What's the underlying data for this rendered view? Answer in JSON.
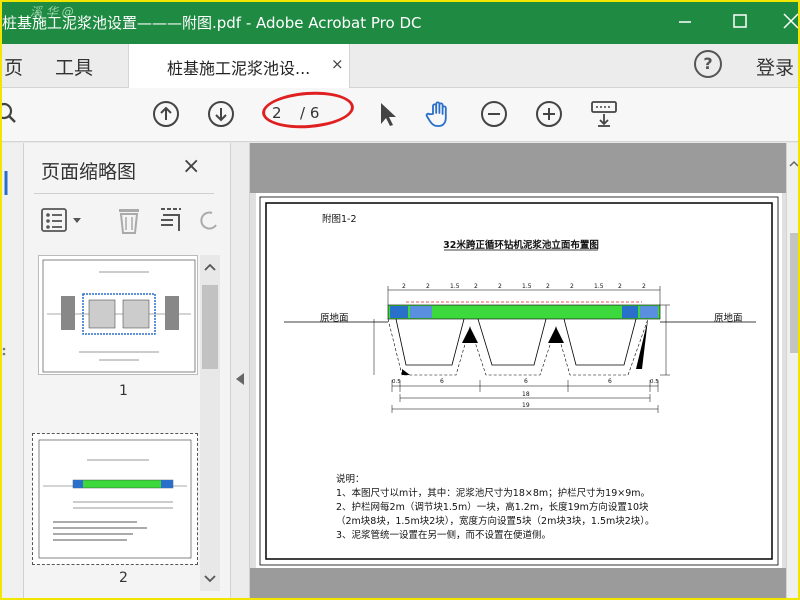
{
  "window": {
    "title": "桩基施工泥浆池设置———附图.pdf - Adobe Acrobat Pro DC",
    "watermark": "溪 华 @"
  },
  "menu": {
    "home": "页",
    "tools": "工具",
    "login": "登录"
  },
  "tab": {
    "label": "桩基施工泥浆池设...",
    "close": "×"
  },
  "toolbar": {
    "current_page": "2",
    "total_pages": "/ 6"
  },
  "thumbnails": {
    "title": "页面缩略图",
    "close": "×",
    "items": [
      {
        "number": "1"
      },
      {
        "number": "2"
      }
    ]
  },
  "drawing": {
    "figure_label": "附图1-2",
    "title": "32米跨正循环钻机泥浆池立面布置图",
    "ground_left": "原地面",
    "ground_right": "原地面",
    "dims_top": [
      "2",
      "2",
      "1.5",
      "2",
      "2",
      "1.5",
      "2",
      "2",
      "1.5",
      "2",
      "2"
    ],
    "dims_bottom_left": "0.5",
    "dims_bottom": [
      "6",
      "6",
      "6"
    ],
    "dims_bottom_right": "0.5",
    "dim_total_1": "18",
    "dim_total_2": "19",
    "notes_title": "说明：",
    "notes": [
      "1、本图尺寸以m计，其中：泥浆池尺寸为18×8m；护栏尺寸为19×9m。",
      "2、护栏网每2m（调节块1.5m）一块，高1.2m，长度19m方向设置10块",
      "（2m块8块，1.5m块2块），宽度方向设置5块（2m块3块，1.5m块2块）。",
      "3、泥浆管统一设置在另一侧，而不设置在便道侧。"
    ]
  },
  "colors": {
    "titlebar": "#1e8a42",
    "accent_blue": "#2a6fc9",
    "annotation_red": "#e02020"
  }
}
